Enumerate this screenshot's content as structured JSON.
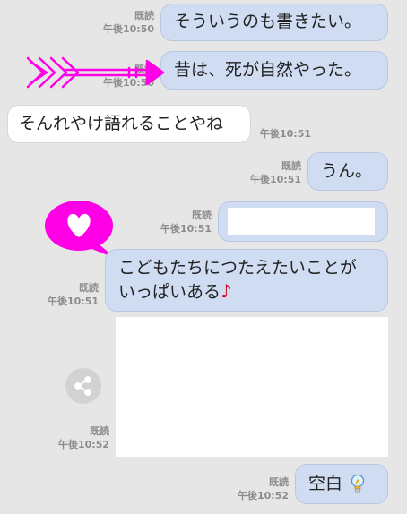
{
  "colors": {
    "background": "#e6e6e6",
    "sent_bubble": "#cfdcf2",
    "received_bubble": "#ffffff",
    "meta_text": "#8c8c8c",
    "sticker_magenta": "#ff00e6",
    "note_red": "#e0001a"
  },
  "messages": [
    {
      "direction": "sent",
      "read": "既読",
      "time": "午後10:50",
      "text": "そういうのも書きたい。"
    },
    {
      "direction": "sent",
      "read": "既読",
      "time": "午後10:50",
      "text": "昔は、死が自然やった。"
    },
    {
      "direction": "received",
      "time": "午後10:51",
      "text": "そんれやけ語れることやね"
    },
    {
      "direction": "sent",
      "read": "既読",
      "time": "午後10:51",
      "text": "うん。"
    },
    {
      "direction": "sent",
      "read": "既読",
      "time": "午後10:51",
      "text": ""
    },
    {
      "direction": "sent",
      "read": "既読",
      "time": "午後10:51",
      "text_line1": "こどもたちにつたえたいことが",
      "text_line2": "いっぱいある",
      "note": "♪"
    },
    {
      "direction": "sent",
      "read": "既読",
      "time": "午後10:52",
      "type": "image"
    },
    {
      "direction": "sent",
      "read": "既読",
      "time": "午後10:52",
      "text": "空白"
    }
  ],
  "decorations": {
    "arrow": "arrow-sticker",
    "heart": "heart-speech-sticker",
    "share": "share-icon",
    "bulb": "lightbulb-icon"
  }
}
